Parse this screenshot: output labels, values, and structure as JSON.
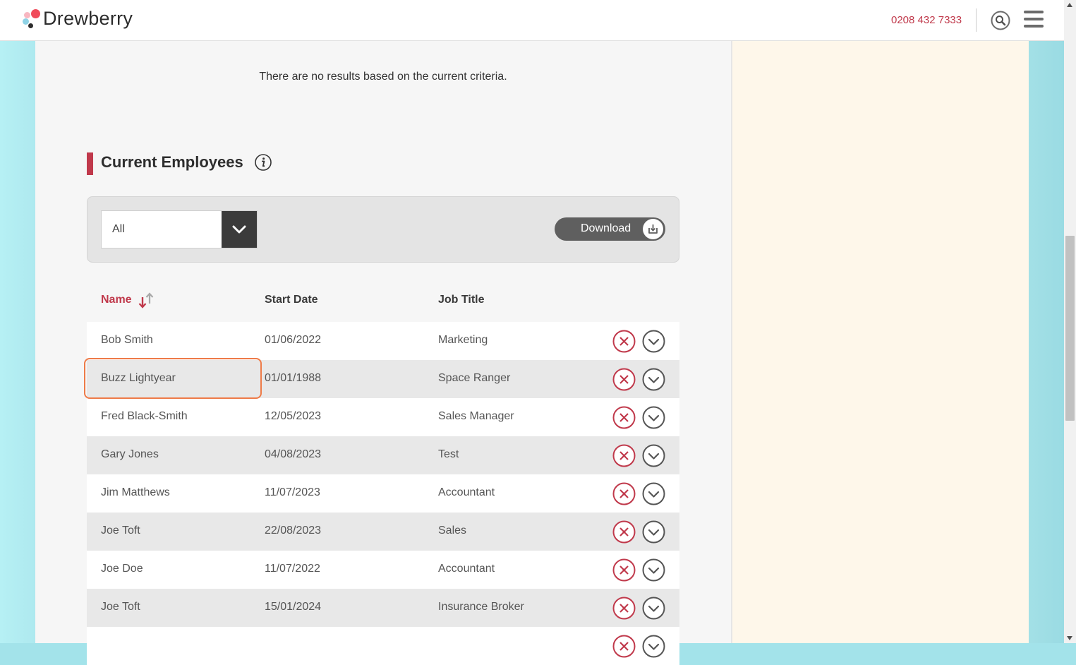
{
  "header": {
    "brand": "Drewberry",
    "phone": "0208 432 7333",
    "colors": {
      "accent": "#c0394b",
      "logo_dots": [
        "#f04b5a",
        "#f8b7c1",
        "#8fd3e6",
        "#2d2d2d"
      ]
    }
  },
  "main": {
    "no_results_text": "There are no results based on the current criteria.",
    "section_title": "Current Employees",
    "filter": {
      "selected": "All"
    },
    "download_label": "Download",
    "table": {
      "columns": [
        "Name",
        "Start Date",
        "Job Title"
      ],
      "sort": {
        "column": "Name",
        "direction": "descending"
      },
      "rows": [
        {
          "name": "Bob Smith",
          "start_date": "01/06/2022",
          "job_title": "Marketing"
        },
        {
          "name": "Buzz Lightyear",
          "start_date": "01/01/1988",
          "job_title": "Space Ranger"
        },
        {
          "name": "Fred Black-Smith",
          "start_date": "12/05/2023",
          "job_title": "Sales Manager"
        },
        {
          "name": "Gary Jones",
          "start_date": "04/08/2023",
          "job_title": "Test"
        },
        {
          "name": "Jim Matthews",
          "start_date": "11/07/2023",
          "job_title": "Accountant"
        },
        {
          "name": "Joe Toft",
          "start_date": "22/08/2023",
          "job_title": "Sales"
        },
        {
          "name": "Joe Doe",
          "start_date": "11/07/2022",
          "job_title": "Accountant"
        },
        {
          "name": "Joe Toft",
          "start_date": "15/01/2024",
          "job_title": "Insurance Broker"
        }
      ]
    }
  }
}
